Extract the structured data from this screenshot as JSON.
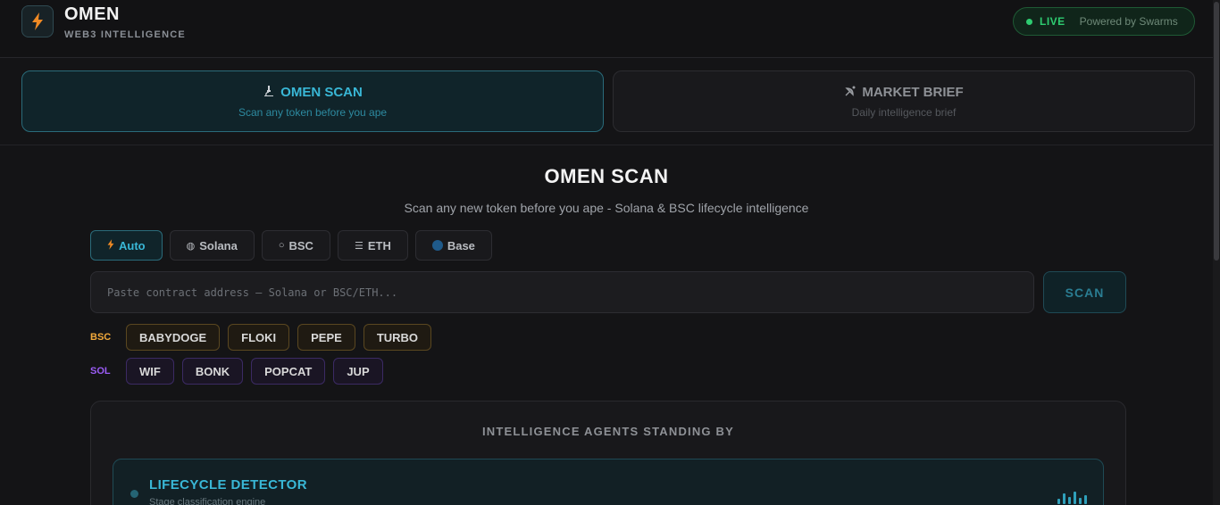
{
  "header": {
    "brand": "OMEN",
    "tagline": "WEB3 INTELLIGENCE",
    "status": "LIVE",
    "powered_by": "Powered by Swarms"
  },
  "modes": [
    {
      "icon": "microscope-icon",
      "title": "OMEN SCAN",
      "subtitle": "Scan any token before you ape",
      "active": true
    },
    {
      "icon": "satellite-dish-icon",
      "title": "MARKET BRIEF",
      "subtitle": "Daily intelligence brief",
      "active": false
    }
  ],
  "main": {
    "title": "OMEN SCAN",
    "subtitle": "Scan any new token before you ape - Solana & BSC lifecycle intelligence"
  },
  "chains": [
    {
      "label": "Auto",
      "icon": "lightning-icon",
      "active": true
    },
    {
      "label": "Solana",
      "icon": "globe-icon",
      "active": false
    },
    {
      "label": "BSC",
      "icon": "ring-icon",
      "active": false
    },
    {
      "label": "ETH",
      "icon": "ethereum-icon",
      "active": false
    },
    {
      "label": "Base",
      "icon": "base-dot-icon",
      "active": false
    }
  ],
  "search": {
    "value": "",
    "placeholder": "Paste contract address — Solana or BSC/ETH...",
    "button": "SCAN"
  },
  "quick": {
    "bsc": {
      "label": "BSC",
      "tokens": [
        "BABYDOGE",
        "FLOKI",
        "PEPE",
        "TURBO"
      ]
    },
    "sol": {
      "label": "SOL",
      "tokens": [
        "WIF",
        "BONK",
        "POPCAT",
        "JUP"
      ]
    }
  },
  "agents": {
    "title": "INTELLIGENCE AGENTS STANDING BY",
    "items": [
      {
        "name": "LIFECYCLE DETECTOR",
        "description": "Stage classification engine"
      }
    ]
  },
  "colors": {
    "accent": "#39b7d6",
    "live": "#2ecc71",
    "bsc": "#f2a93b",
    "sol": "#9b5cf6",
    "logo": "#f08a24"
  }
}
